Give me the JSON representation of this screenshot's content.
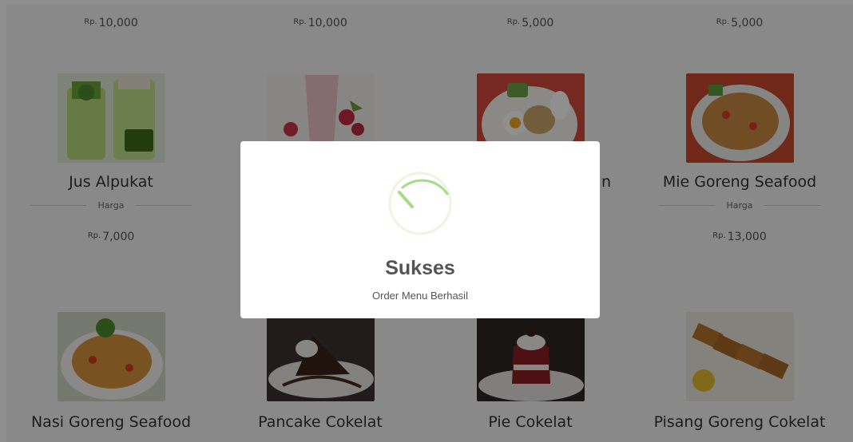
{
  "menu": {
    "top_prices": [
      "10,000",
      "10,000",
      "5,000",
      "5,000"
    ],
    "currency_prefix": "Rp.",
    "row1_items": [
      {
        "name": "Jus Alpukat",
        "price_label": "Harga",
        "price": "7,000"
      },
      {
        "name": "",
        "price_label": "",
        "price": ""
      },
      {
        "name": "n",
        "price_label": "",
        "price": ""
      },
      {
        "name": "Mie Goreng Seafood",
        "price_label": "Harga",
        "price": "13,000"
      }
    ],
    "row2_items": [
      {
        "name": "Nasi Goreng Seafood"
      },
      {
        "name": "Pancake Cokelat"
      },
      {
        "name": "Pie Cokelat"
      },
      {
        "name": "Pisang Goreng Cokelat"
      }
    ]
  },
  "modal": {
    "title": "Sukses",
    "message": "Order Menu Berhasil",
    "success_color": "#a5dc86"
  },
  "colors": {
    "overlay": "rgba(0,0,0,0.44)",
    "card_bg": "#f4f4f4"
  }
}
